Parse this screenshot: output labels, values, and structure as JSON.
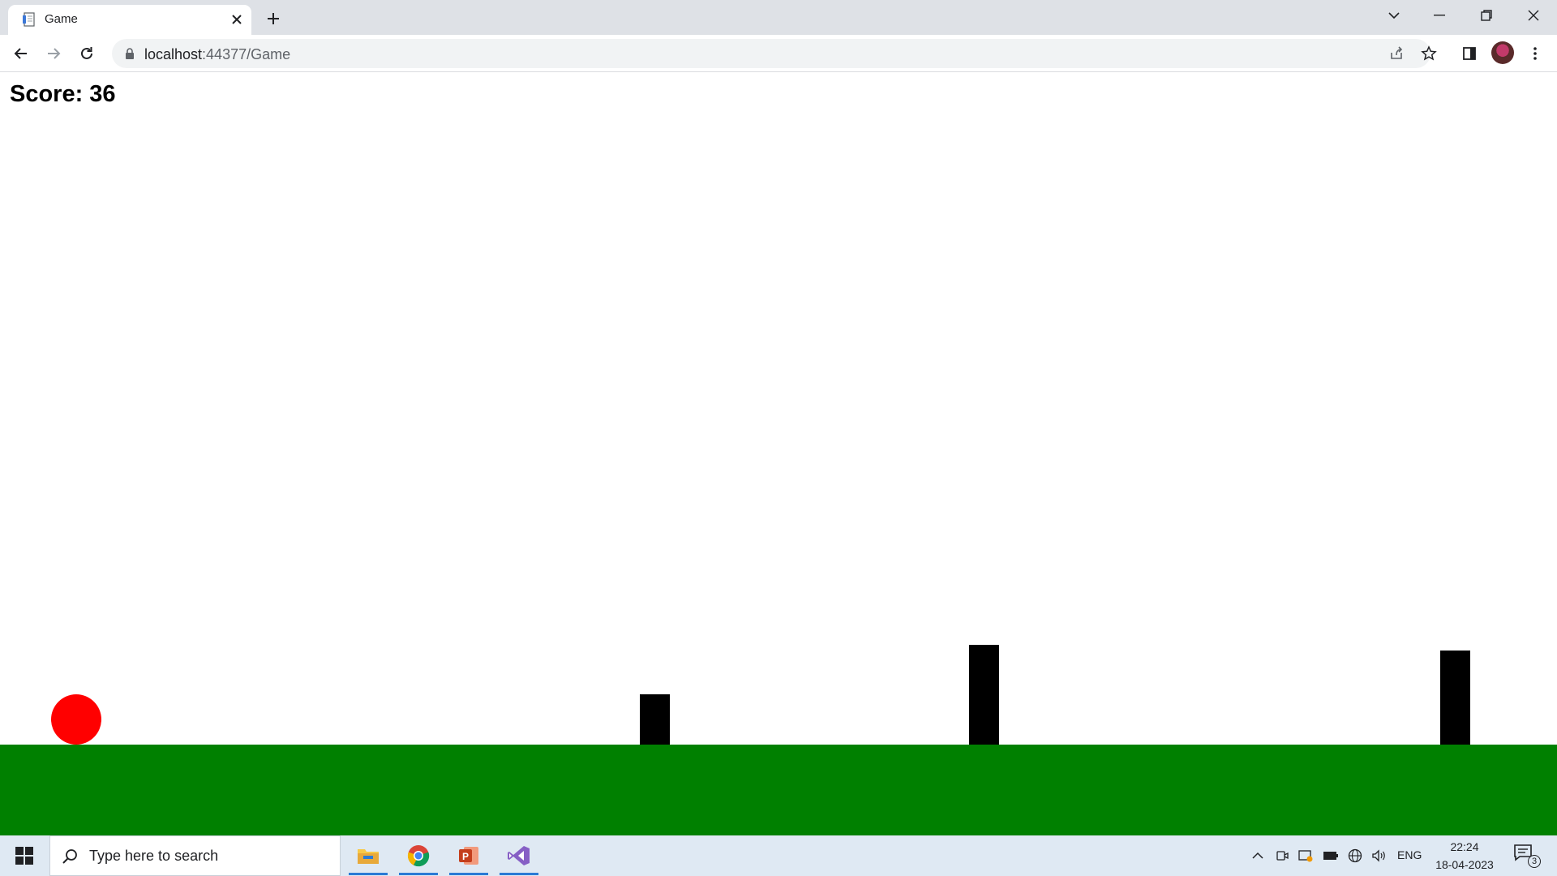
{
  "browser": {
    "tab_title": "Game",
    "url_host": "localhost",
    "url_path": ":44377/Game"
  },
  "game": {
    "score_label": "Score:",
    "score_value": "36",
    "ball_color": "#ff0000",
    "obstacle_color": "#000000",
    "ground_color": "#008000"
  },
  "taskbar": {
    "search_placeholder": "Type here to search",
    "apps": [
      "file-explorer-icon",
      "chrome-icon",
      "powerpoint-icon",
      "visual-studio-icon"
    ],
    "language": "ENG",
    "time": "22:24",
    "date": "18-04-2023",
    "notification_count": "3"
  }
}
